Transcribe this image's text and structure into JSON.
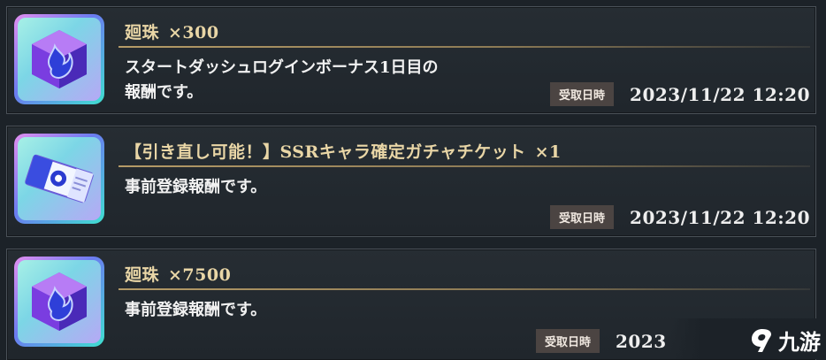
{
  "rewards": [
    {
      "title": "廻珠",
      "quantity": "×300",
      "description": "スタートダッシュログインボーナス1日目の\n報酬です。",
      "received_label": "受取日時",
      "received_at": "2023/11/22 12:20",
      "icon": "cube-gem-icon"
    },
    {
      "title": "【引き直し可能！】SSRキャラ確定ガチャチケット",
      "quantity": "×1",
      "description": "事前登録報酬です。",
      "received_label": "受取日時",
      "received_at": "2023/11/22 12:20",
      "icon": "gacha-ticket-icon"
    },
    {
      "title": "廻珠",
      "quantity": "×7500",
      "description": "事前登録報酬です。",
      "received_label": "受取日時",
      "received_at": "2023",
      "icon": "cube-gem-icon"
    }
  ],
  "watermark": {
    "text": "九游",
    "icon": "nine-game-logo-icon"
  },
  "colors": {
    "background": "#1c2228",
    "title_gold": "#e9d6a6",
    "label_bg": "#4b4442"
  }
}
